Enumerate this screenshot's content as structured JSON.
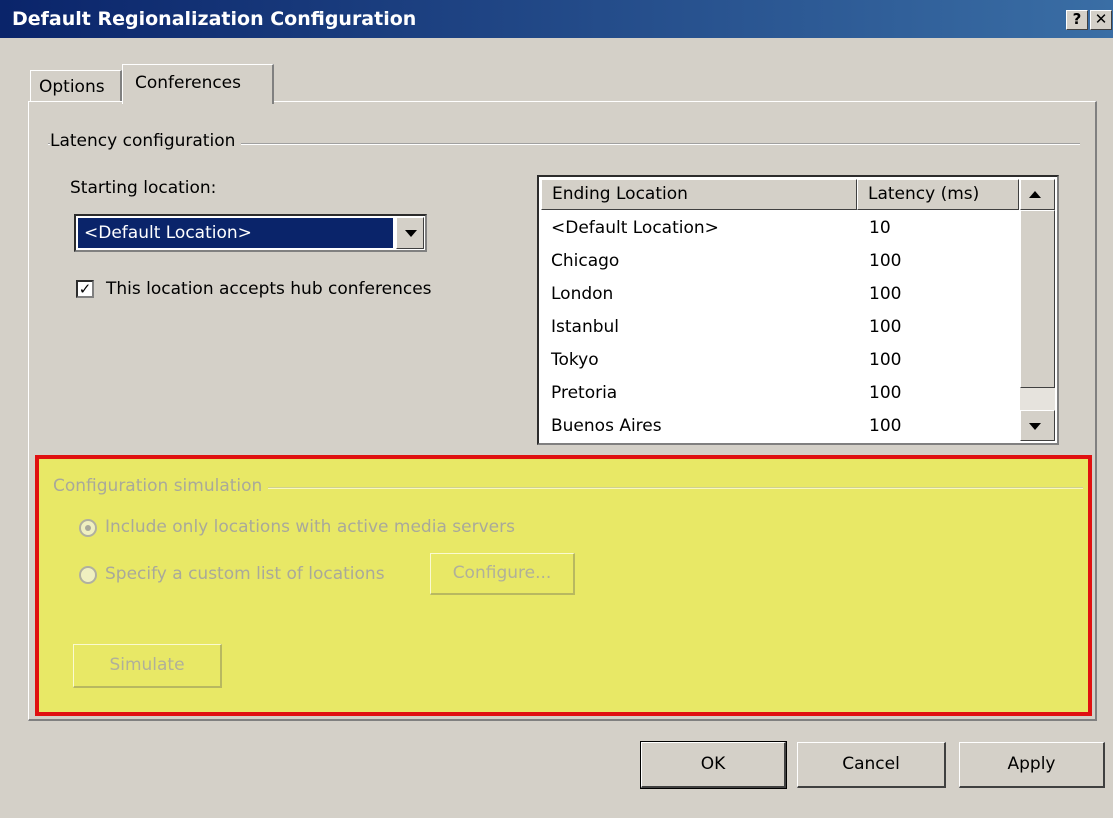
{
  "window": {
    "title": "Default Regionalization Configuration",
    "help_label": "?",
    "close_label": "✕"
  },
  "tabs": [
    {
      "label": "Options",
      "selected": false
    },
    {
      "label": "Conferences",
      "selected": true
    }
  ],
  "latency": {
    "group_label": "Latency configuration",
    "starting_label": "Starting location:",
    "starting_value": "<Default Location>",
    "hub_checkbox_label": "This location accepts hub conferences",
    "hub_checked": true,
    "hub_check_glyph": "✓",
    "columns": [
      "Ending Location",
      "Latency (ms)"
    ],
    "rows": [
      {
        "location": "<Default Location>",
        "latency": "10"
      },
      {
        "location": "Chicago",
        "latency": "100"
      },
      {
        "location": "London",
        "latency": "100"
      },
      {
        "location": "Istanbul",
        "latency": "100"
      },
      {
        "location": "Tokyo",
        "latency": "100"
      },
      {
        "location": "Pretoria",
        "latency": "100"
      },
      {
        "location": "Buenos Aires",
        "latency": "100"
      }
    ]
  },
  "simulation": {
    "group_label": "Configuration simulation",
    "option_active": "Include only locations with active media servers",
    "option_custom": "Specify a custom list of locations",
    "selected_option": "option_active",
    "configure_label": "Configure...",
    "simulate_label": "Simulate",
    "highlight_fill": "#e8e866",
    "highlight_border": "#e01010"
  },
  "buttons": {
    "ok": "OK",
    "cancel": "Cancel",
    "apply": "Apply"
  }
}
